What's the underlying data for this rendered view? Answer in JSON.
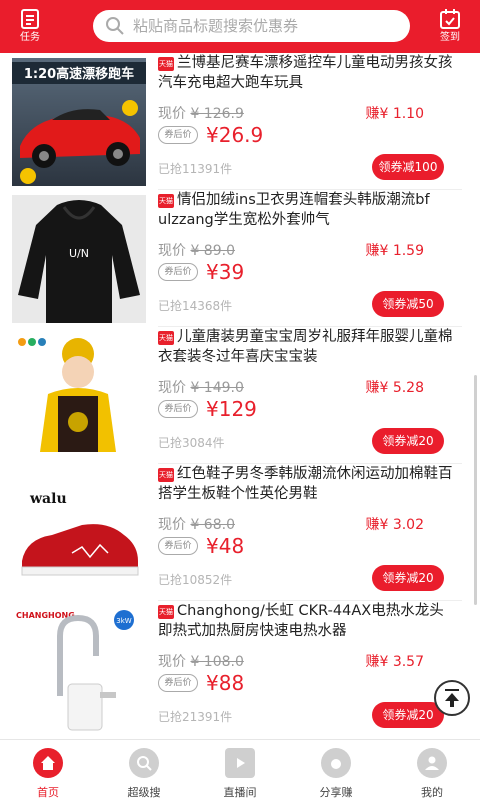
{
  "header": {
    "task_label": "任务",
    "signin_label": "签到",
    "search_placeholder": "粘贴商品标题搜索优惠券"
  },
  "common": {
    "orig_prefix": "现价",
    "coupon_tag": "券后价",
    "brand_tag": "天猫"
  },
  "products": [
    {
      "title": "兰博基尼赛车漂移遥控车儿童电动男孩女孩汽车充电超大跑车玩具",
      "orig_price": "¥ 126.9",
      "price": "¥26.9",
      "earn": "赚¥ 1.10",
      "sold": "已抢11391件",
      "coupon": "领券减100",
      "thumb_caption": "1:20高速漂移跑车"
    },
    {
      "title": "情侣加绒ins卫衣男连帽套头韩版潮流bf ulzzang学生宽松外套帅气",
      "orig_price": "¥ 89.0",
      "price": "¥39",
      "earn": "赚¥ 1.59",
      "sold": "已抢14368件",
      "coupon": "领券减50",
      "thumb_caption": "U/N"
    },
    {
      "title": "儿童唐装男童宝宝周岁礼服拜年服婴儿童棉衣套装冬过年喜庆宝宝装",
      "orig_price": "¥ 149.0",
      "price": "¥129",
      "earn": "赚¥ 5.28",
      "sold": "已抢3084件",
      "coupon": "领券减20",
      "thumb_caption": ""
    },
    {
      "title": "红色鞋子男冬季韩版潮流休闲运动加棉鞋百搭学生板鞋个性英伦男鞋",
      "orig_price": "¥ 68.0",
      "price": "¥48",
      "earn": "赚¥ 3.02",
      "sold": "已抢10852件",
      "coupon": "领券减20",
      "thumb_caption": "walu"
    },
    {
      "title": "Changhong/长虹 CKR-44AX电热水龙头即热式加热厨房快速电热水器",
      "orig_price": "¥ 108.0",
      "price": "¥88",
      "earn": "赚¥ 3.57",
      "sold": "已抢21391件",
      "coupon": "领券减20",
      "thumb_caption": "CHANGHONG",
      "thumb_badge": "3kW"
    }
  ],
  "tabs": [
    {
      "label": "首页",
      "icon": "home-icon",
      "active": true
    },
    {
      "label": "超级搜",
      "icon": "search-icon",
      "active": false
    },
    {
      "label": "直播间",
      "icon": "tv-icon",
      "active": false
    },
    {
      "label": "分享赚",
      "icon": "share-money-icon",
      "active": false
    },
    {
      "label": "我的",
      "icon": "user-icon",
      "active": false
    }
  ],
  "colors": {
    "accent": "#ea1d2c",
    "price": "#e8202c",
    "muted": "#999999"
  }
}
